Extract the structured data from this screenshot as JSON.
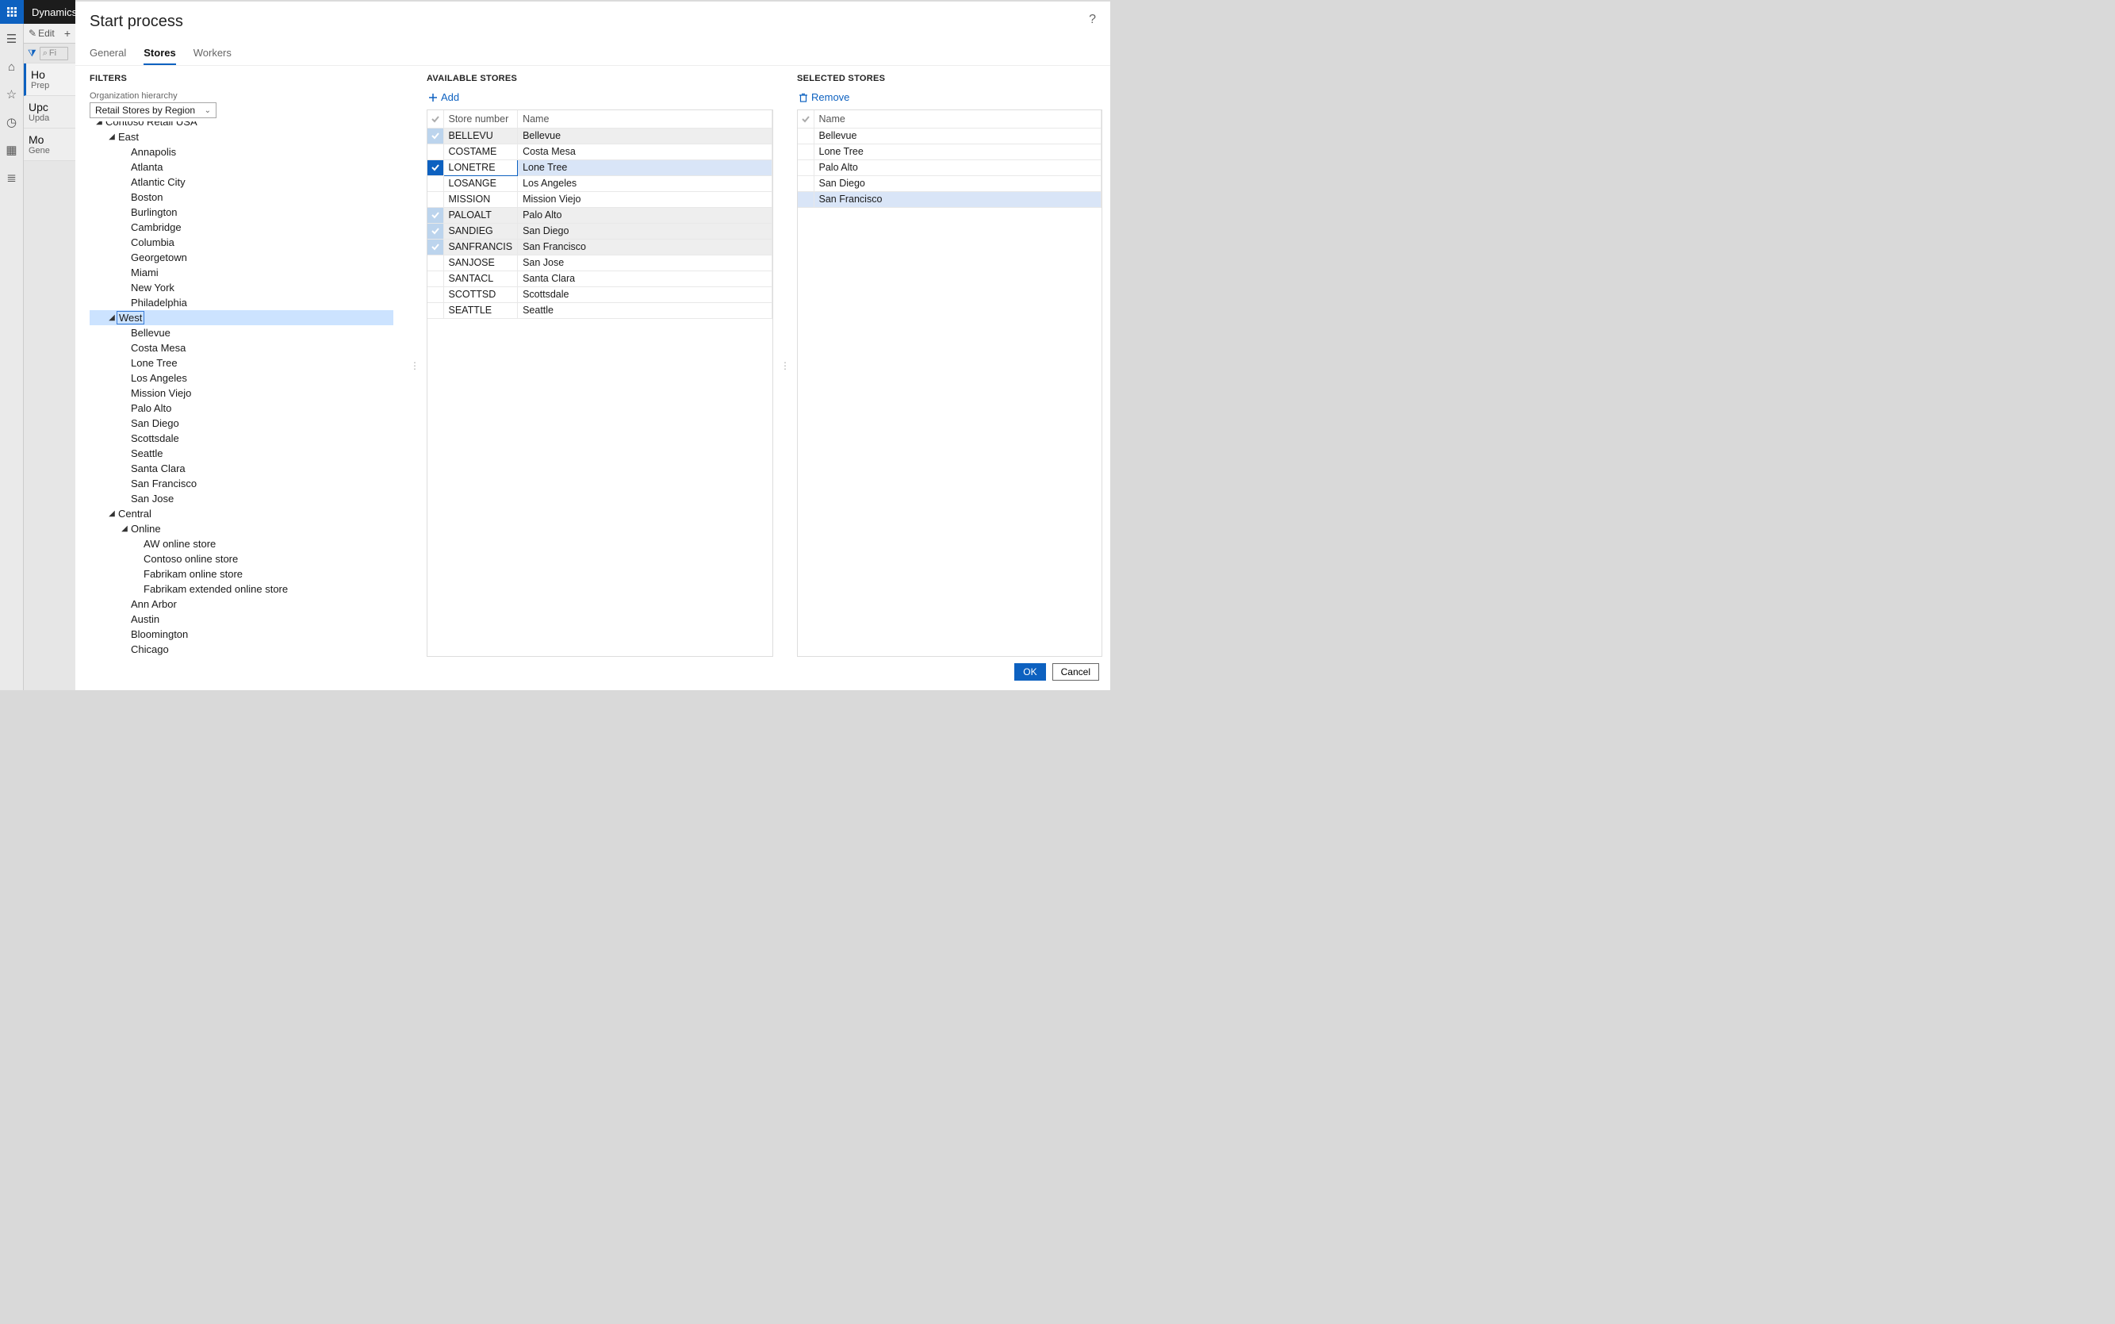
{
  "header": {
    "brand": "Dynamics"
  },
  "toolbar": {
    "edit": "Edit"
  },
  "list_filter_placeholder": "Fi",
  "bg_cards": [
    {
      "title": "Ho",
      "sub": "Prep",
      "selected": true
    },
    {
      "title": "Upc",
      "sub": "Upda",
      "selected": false
    },
    {
      "title": "Mo",
      "sub": "Gene",
      "selected": false
    }
  ],
  "dialog": {
    "title": "Start process",
    "tabs": {
      "general": "General",
      "stores": "Stores",
      "workers": "Workers",
      "active": "stores"
    },
    "filters": {
      "heading": "FILTERS",
      "field_label": "Organization hierarchy",
      "field_value": "Retail Stores by Region"
    },
    "tree": [
      {
        "depth": 1,
        "label": "Contoso Retail USA",
        "expanded": true
      },
      {
        "depth": 2,
        "label": "East",
        "expanded": true
      },
      {
        "depth": 3,
        "label": "Annapolis"
      },
      {
        "depth": 3,
        "label": "Atlanta"
      },
      {
        "depth": 3,
        "label": "Atlantic City"
      },
      {
        "depth": 3,
        "label": "Boston"
      },
      {
        "depth": 3,
        "label": "Burlington"
      },
      {
        "depth": 3,
        "label": "Cambridge"
      },
      {
        "depth": 3,
        "label": "Columbia"
      },
      {
        "depth": 3,
        "label": "Georgetown"
      },
      {
        "depth": 3,
        "label": "Miami"
      },
      {
        "depth": 3,
        "label": "New York"
      },
      {
        "depth": 3,
        "label": "Philadelphia"
      },
      {
        "depth": 2,
        "label": "West",
        "expanded": true,
        "selected": true
      },
      {
        "depth": 3,
        "label": "Bellevue"
      },
      {
        "depth": 3,
        "label": "Costa Mesa"
      },
      {
        "depth": 3,
        "label": "Lone Tree"
      },
      {
        "depth": 3,
        "label": "Los Angeles"
      },
      {
        "depth": 3,
        "label": "Mission Viejo"
      },
      {
        "depth": 3,
        "label": "Palo Alto"
      },
      {
        "depth": 3,
        "label": "San Diego"
      },
      {
        "depth": 3,
        "label": "Scottsdale"
      },
      {
        "depth": 3,
        "label": "Seattle"
      },
      {
        "depth": 3,
        "label": "Santa Clara"
      },
      {
        "depth": 3,
        "label": "San Francisco"
      },
      {
        "depth": 3,
        "label": "San Jose"
      },
      {
        "depth": 2,
        "label": "Central",
        "expanded": true
      },
      {
        "depth": 3,
        "label": "Online",
        "expanded": true
      },
      {
        "depth": 4,
        "label": "AW online store"
      },
      {
        "depth": 4,
        "label": "Contoso online store"
      },
      {
        "depth": 4,
        "label": "Fabrikam online store"
      },
      {
        "depth": 4,
        "label": "Fabrikam extended online store"
      },
      {
        "depth": 3,
        "label": "Ann Arbor"
      },
      {
        "depth": 3,
        "label": "Austin"
      },
      {
        "depth": 3,
        "label": "Bloomington"
      },
      {
        "depth": 3,
        "label": "Chicago"
      }
    ],
    "available": {
      "heading": "AVAILABLE STORES",
      "add_label": "Add",
      "columns": {
        "num": "Store number",
        "name": "Name"
      },
      "rows": [
        {
          "num": "BELLEVU",
          "name": "Bellevue",
          "checked": true
        },
        {
          "num": "COSTAME",
          "name": "Costa Mesa",
          "checked": false
        },
        {
          "num": "LONETRE",
          "name": "Lone Tree",
          "checked": true,
          "current": true
        },
        {
          "num": "LOSANGE",
          "name": "Los Angeles",
          "checked": false
        },
        {
          "num": "MISSION",
          "name": "Mission Viejo",
          "checked": false
        },
        {
          "num": "PALOALT",
          "name": "Palo Alto",
          "checked": true
        },
        {
          "num": "SANDIEG",
          "name": "San Diego",
          "checked": true
        },
        {
          "num": "SANFRANCIS",
          "name": "San Francisco",
          "checked": true
        },
        {
          "num": "SANJOSE",
          "name": "San Jose",
          "checked": false
        },
        {
          "num": "SANTACL",
          "name": "Santa Clara",
          "checked": false
        },
        {
          "num": "SCOTTSD",
          "name": "Scottsdale",
          "checked": false
        },
        {
          "num": "SEATTLE",
          "name": "Seattle",
          "checked": false
        }
      ]
    },
    "selected": {
      "heading": "SELECTED STORES",
      "remove_label": "Remove",
      "column": "Name",
      "rows": [
        {
          "name": "Bellevue"
        },
        {
          "name": "Lone Tree"
        },
        {
          "name": "Palo Alto"
        },
        {
          "name": "San Diego"
        },
        {
          "name": "San Francisco",
          "highlight": true
        }
      ]
    },
    "buttons": {
      "ok": "OK",
      "cancel": "Cancel"
    }
  }
}
